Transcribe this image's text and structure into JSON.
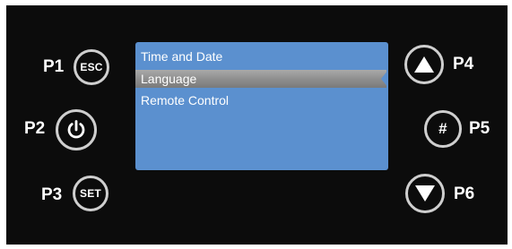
{
  "labels": {
    "p1": "P1",
    "p2": "P2",
    "p3": "P3",
    "p4": "P4",
    "p5": "P5",
    "p6": "P6"
  },
  "buttons": {
    "esc": "ESC",
    "power": "power-icon",
    "set": "SET",
    "up": "arrow-up-icon",
    "hash": "#",
    "down": "arrow-down-icon"
  },
  "menu": {
    "items": [
      {
        "label": "Time and Date",
        "selected": false
      },
      {
        "label": "Language",
        "selected": true
      },
      {
        "label": "Remote Control",
        "selected": false
      }
    ]
  },
  "colors": {
    "panel": "#0c0c0c",
    "screen": "#5b90cf",
    "button_ring": "#cfcfcf",
    "selection": "#9a9a9a"
  }
}
